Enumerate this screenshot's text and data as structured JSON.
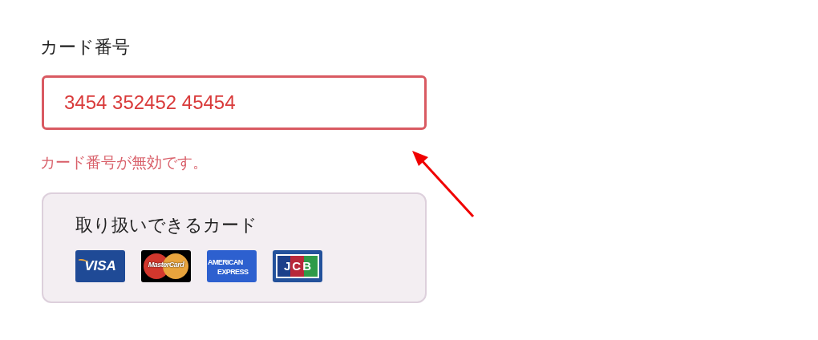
{
  "card_number": {
    "label": "カード番号",
    "value": "3454 352452 45454",
    "invalid": true,
    "error": "カード番号が無効です。"
  },
  "accepted_cards": {
    "title": "取り扱いできるカード",
    "cards": [
      {
        "kind": "visa",
        "text": [
          "VISA"
        ]
      },
      {
        "kind": "mastercard",
        "text": [
          "MasterCard"
        ]
      },
      {
        "kind": "amex",
        "text": [
          "AMERICAN",
          "EXPRESS"
        ]
      },
      {
        "kind": "jcb",
        "text": [
          "JCB"
        ]
      }
    ]
  }
}
